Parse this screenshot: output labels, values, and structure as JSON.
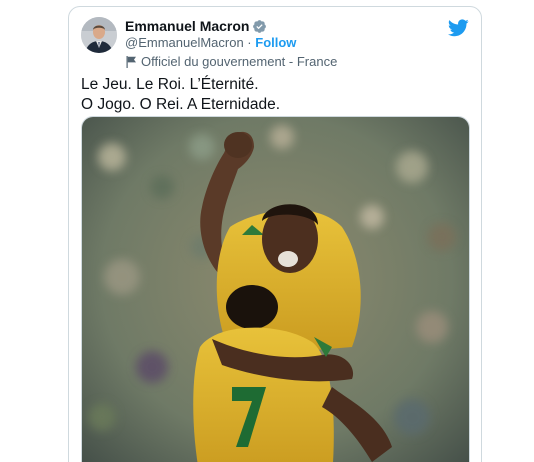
{
  "author": {
    "display_name": "Emmanuel Macron",
    "handle": "@EmmanuelMacron",
    "separator": " · ",
    "follow_label": "Follow",
    "account_label": "Officiel du gouvernement - France",
    "verified_icon": "verified-badge-icon",
    "brand_color": "#1d9bf0"
  },
  "tweet": {
    "line1": "Le Jeu. Le Roi. L’Éternité.",
    "line2": "O Jogo. O Rei. A Eternidade."
  },
  "media": {
    "jersey_number": "7"
  }
}
